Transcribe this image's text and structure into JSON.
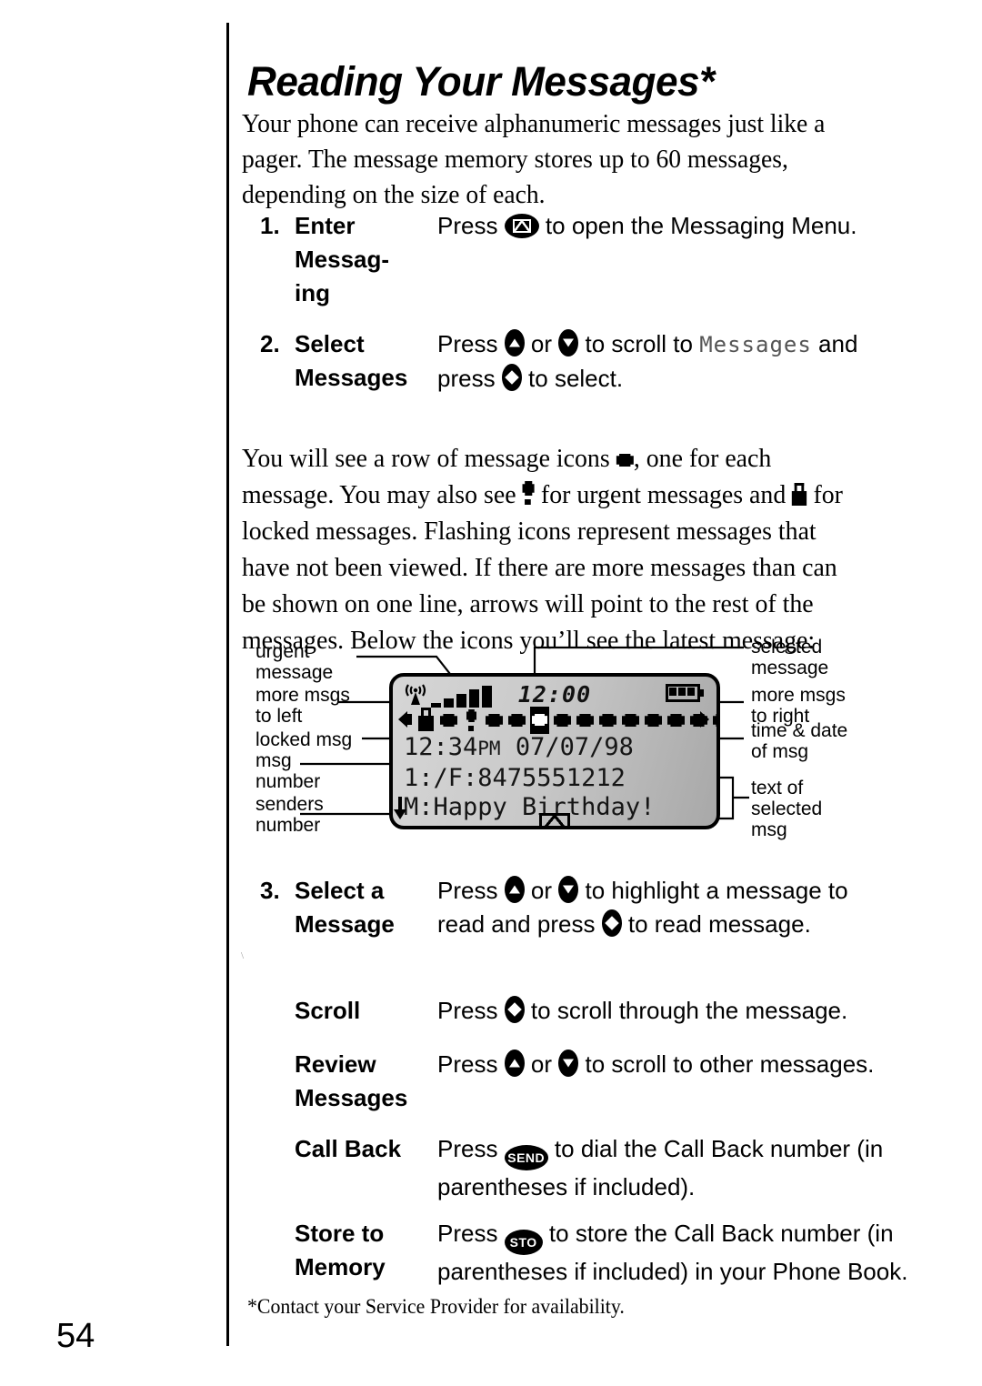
{
  "page": {
    "title": "Reading Your Messages*",
    "number": "54",
    "footnote": "*Contact your Service Provider for availability."
  },
  "intro": "Your phone can receive alphanumeric messages just like a pager. The message memory stores up to 60 messages, depending on the size of each.",
  "steps": [
    {
      "num": "1.",
      "term_lines": [
        "Enter",
        "Messag-",
        "ing"
      ],
      "desc_parts": [
        "Press ",
        " to open the Messaging Menu."
      ],
      "desc_lines": [
        "Press ⟨envelope-key⟩ to open the Messaging Menu."
      ]
    },
    {
      "num": "2.",
      "term_lines": [
        "Select",
        "Messages"
      ],
      "desc_line1_a": "Press ",
      "desc_line1_b": " or ",
      "desc_line1_c": " to scroll to ",
      "desc_line1_lcd": "Messages",
      "desc_line1_d": " and",
      "desc_line2_a": "press ",
      "desc_line2_b": " to select."
    },
    {
      "num": "3.",
      "term_lines": [
        "Select a",
        "Message"
      ],
      "desc_line1_a": "Press ",
      "desc_line1_b": " or ",
      "desc_line1_c": " to highlight a message to",
      "desc_line2_a": "read and press ",
      "desc_line2_b": " to read message."
    }
  ],
  "actions": [
    {
      "term_lines": [
        "Scroll"
      ],
      "desc_line1_a": "Press ",
      "desc_line1_b": " to scroll through the message."
    },
    {
      "term_lines": [
        "Review",
        "Messages"
      ],
      "desc_line1_a": "Press ",
      "desc_line1_b": " or ",
      "desc_line1_c": " to scroll to other messages."
    },
    {
      "term_lines": [
        "Call Back"
      ],
      "key_label": "SEND",
      "desc_line1_a": "Press ",
      "desc_line1_b": " to dial the Call Back number (in",
      "desc_line2": "parentheses if included)."
    },
    {
      "term_lines": [
        "Store to",
        "Memory"
      ],
      "key_label": "STO",
      "desc_line1_a": "Press ",
      "desc_line1_b": " to store the Call Back number (in",
      "desc_line2": "parentheses if included) in your Phone Book."
    }
  ],
  "body_paragraph": {
    "p1": "You will see a row of message icons ",
    "p2": ", one for each message. You may also see ",
    "p3": " for urgent messages and ",
    "p4": " for locked messages. Flashing icons represent messages that have not been viewed. If there are more messages than can be shown on one line, arrows will point to the rest of the messages. Below the icons you’ll see the latest message:"
  },
  "diagram": {
    "callouts_left": [
      "urgent\nmessage",
      "more msgs\nto left",
      "locked msg",
      "msg\nnumber",
      "senders\nnumber"
    ],
    "callouts_right": [
      "selected\nmessage",
      "more msgs\nto right",
      "time & date\nof msg",
      "text of\nselected\nmsg"
    ],
    "lcd": {
      "clock": "12:00",
      "signal_bars": 5,
      "battery_segments": 3,
      "icon_row": [
        "lock",
        "msg",
        "urgent",
        "msg",
        "msg",
        "selected",
        "msg",
        "msg",
        "msg",
        "msg",
        "msg",
        "msg",
        "msg",
        "msg"
      ],
      "arrow_left": "◀",
      "arrow_right": "▶",
      "line1_time": "12:34",
      "line1_ampm": "PM",
      "line1_date": " 07/07/98",
      "line2": "1:/F:8475551212",
      "line3": "M:Happy Birthday!",
      "scroll_down_arrow": "↓"
    }
  },
  "icon_names": {
    "envelope_key": "envelope-key-icon",
    "nav_up": "nav-up-key-icon",
    "nav_down": "nav-down-key-icon",
    "nav_select": "nav-select-key-icon",
    "message": "message-icon",
    "urgent": "urgent-message-icon",
    "locked": "locked-message-icon"
  },
  "colors": {
    "ink": "#000000",
    "paper": "#ffffff",
    "lcd_light": "#d6d6d6",
    "lcd_dark": "#a8a8a8"
  }
}
